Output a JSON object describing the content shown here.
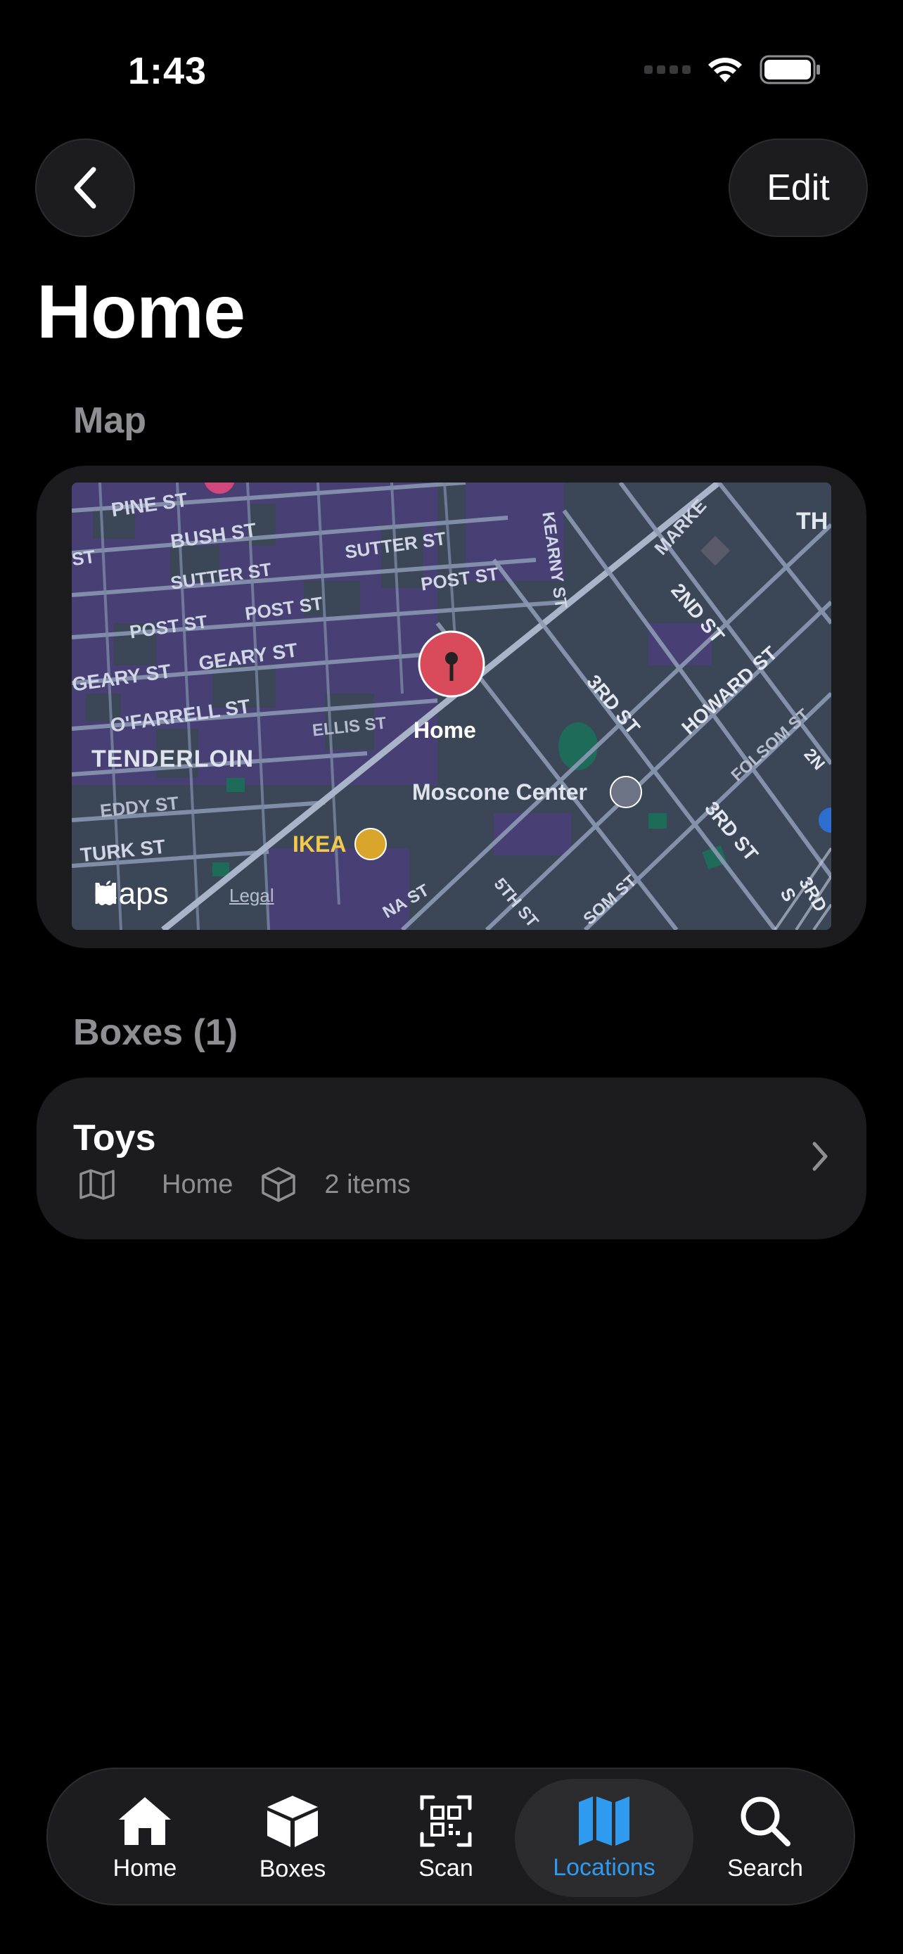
{
  "status_bar": {
    "time": "1:43"
  },
  "nav": {
    "edit_label": "Edit"
  },
  "page": {
    "title": "Home"
  },
  "map_section": {
    "label": "Map",
    "pin_label": "Home",
    "pois": {
      "moscone": "Moscone Center",
      "ikea": "IKEA"
    },
    "district": "TENDERLOIN",
    "streets": [
      "PINE ST",
      "BUSH ST",
      "SUTTER ST",
      "SUTTER ST",
      "POST ST",
      "POST ST",
      "POST ST",
      "GEARY ST",
      "GEARY ST",
      "O'FARRELL ST",
      "ELLIS ST",
      "EDDY ST",
      "TURK ST",
      "KEARNY ST",
      "MARKE",
      "2ND ST",
      "HOWARD ST",
      "3RD ST",
      "3RD ST",
      "FOLSOM ST",
      "5TH ST",
      "SOM ST",
      "TH",
      "3RD S",
      "2N",
      "ST",
      "NA ST"
    ],
    "brand": "Maps",
    "legal": "Legal"
  },
  "boxes_section": {
    "label": "Boxes (1)",
    "items": [
      {
        "name": "Toys",
        "location": "Home",
        "count": "2 items"
      }
    ]
  },
  "tab_bar": {
    "accent_color": "#2e9bf0",
    "tabs": [
      {
        "label": "Home",
        "icon": "house-icon"
      },
      {
        "label": "Boxes",
        "icon": "box-icon"
      },
      {
        "label": "Scan",
        "icon": "qr-code-icon"
      },
      {
        "label": "Locations",
        "icon": "map-icon"
      },
      {
        "label": "Search",
        "icon": "magnifying-glass-icon"
      }
    ],
    "active_tab": "Locations"
  }
}
